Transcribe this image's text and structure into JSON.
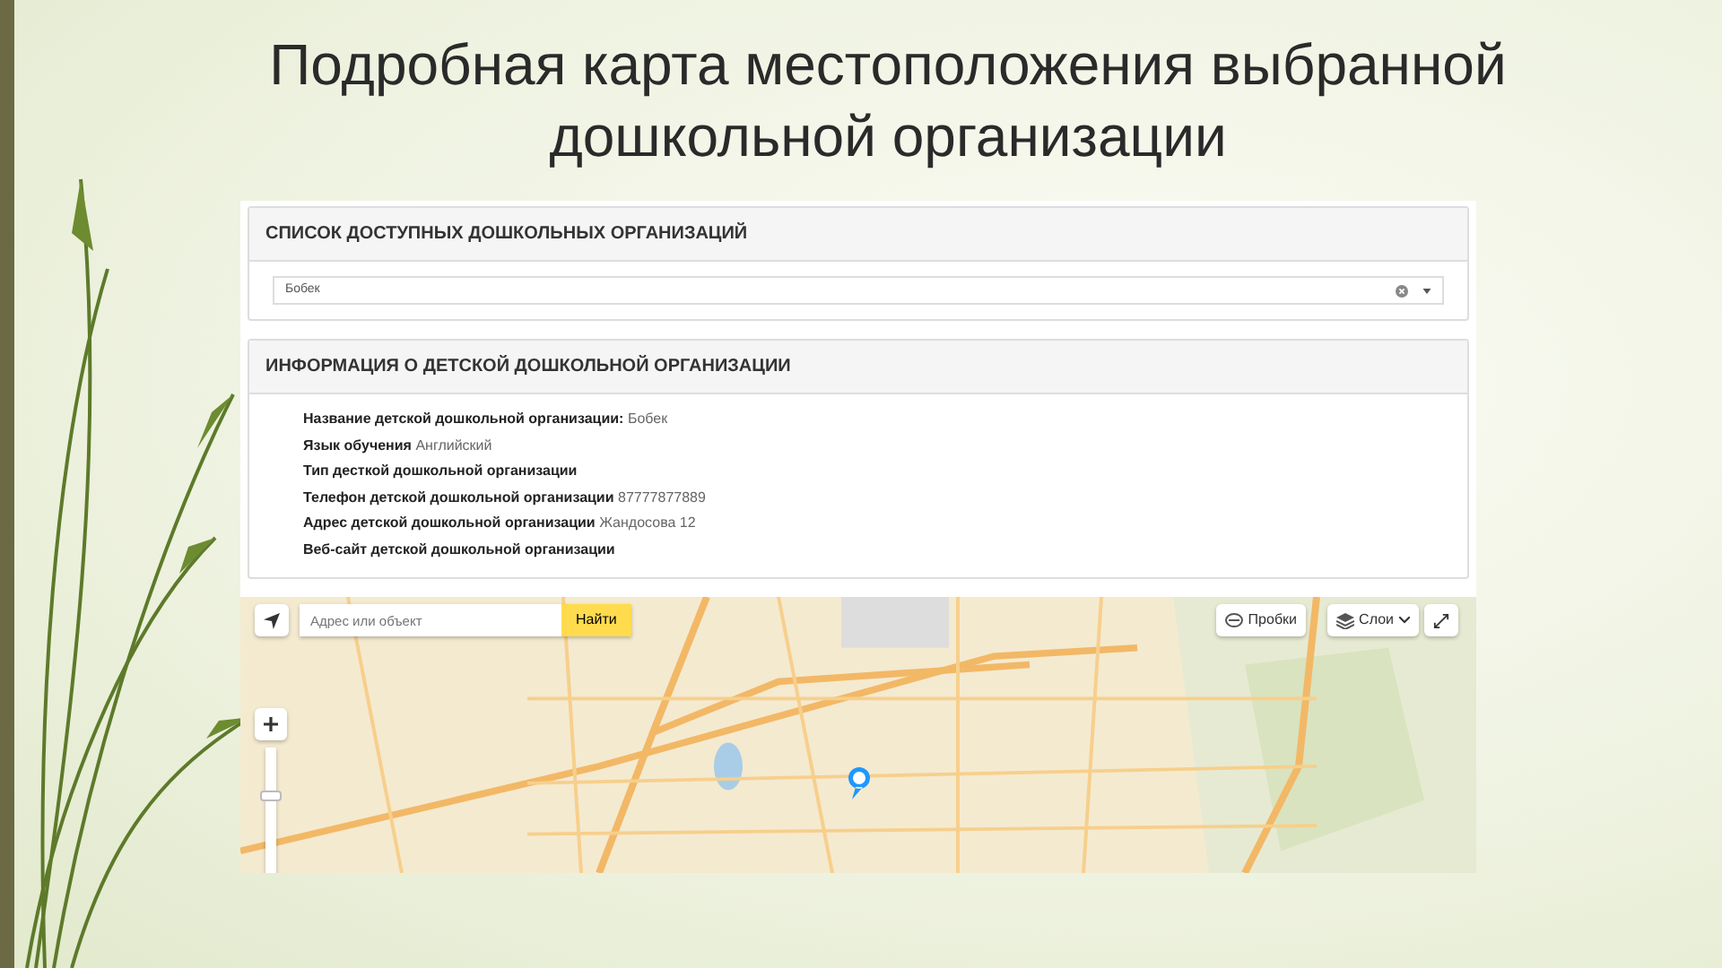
{
  "slide": {
    "title": "Подробная карта местоположения выбранной дошкольной организации"
  },
  "list_panel": {
    "heading": "СПИСОК ДОСТУПНЫХ ДОШКОЛЬНЫХ ОРГАНИЗАЦИЙ",
    "select": {
      "value": "Бобек"
    }
  },
  "info_panel": {
    "heading": "ИНФОРМАЦИЯ О ДЕТСКОЙ ДОШКОЛЬНОЙ ОРГАНИЗАЦИИ",
    "fields": [
      {
        "label": "Название детской дошкольной организации:",
        "value": "Бобек"
      },
      {
        "label": "Язык обучения",
        "value": "Английский"
      },
      {
        "label": "Тип десткой дошкольной организации"
      },
      {
        "label": "Телефон детской дошкольной организации",
        "value": "87777877889"
      },
      {
        "label": "Адрес детской дошкольной организации",
        "value": "Жандосова 12"
      },
      {
        "label": "Веб-сайт детской дошкольной организации"
      }
    ]
  },
  "map": {
    "zoom": {
      "level": 0.75
    },
    "search": {
      "placeholder": "Адрес или объект",
      "button": "Найти"
    },
    "buttons": [
      {
        "kind": "traffic",
        "label": "Пробки"
      },
      {
        "kind": "layers",
        "label": "Слои"
      }
    ]
  }
}
